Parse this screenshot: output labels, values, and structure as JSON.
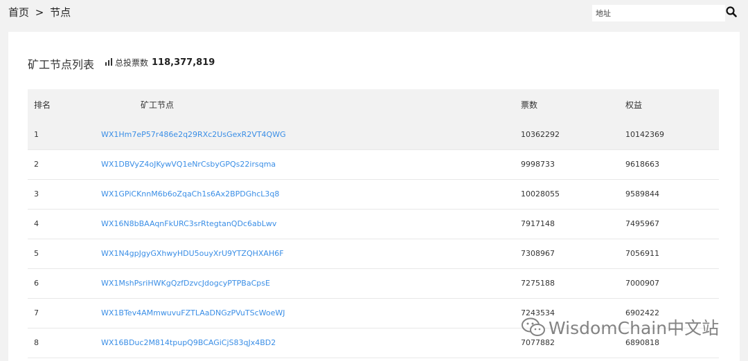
{
  "breadcrumb": {
    "home": "首页",
    "separator": ">",
    "current": "节点"
  },
  "search": {
    "placeholder": "地址",
    "icon": "search-icon"
  },
  "panel": {
    "title": "矿工节点列表",
    "total_votes_label": "总投票数",
    "total_votes_value": "118,377,819",
    "total_votes_icon": "bar-chart-icon"
  },
  "table": {
    "headers": {
      "rank": "排名",
      "node": "矿工节点",
      "votes": "票数",
      "rights": "权益"
    },
    "rows": [
      {
        "rank": "1",
        "node": "WX1Hm7eP57r486e2q29RXc2UsGexR2VT4QWG",
        "votes": "10362292",
        "rights": "10142369"
      },
      {
        "rank": "2",
        "node": "WX1DBVyZ4oJKywVQ1eNrCsbyGPQs22irsqma",
        "votes": "9998733",
        "rights": "9618663"
      },
      {
        "rank": "3",
        "node": "WX1GPiCKnnM6b6oZqaCh1s6Ax2BPDGhcL3q8",
        "votes": "10028055",
        "rights": "9589844"
      },
      {
        "rank": "4",
        "node": "WX16N8bBAAqnFkURC3srRtegtanQDc6abLwv",
        "votes": "7917148",
        "rights": "7495967"
      },
      {
        "rank": "5",
        "node": "WX1N4gpJgyGXhwyHDU5ouyXrU9YTZQHXAH6F",
        "votes": "7308967",
        "rights": "7056911"
      },
      {
        "rank": "6",
        "node": "WX1MshPsriHWKgQzfDzvcJdogcyPTPBaCpsE",
        "votes": "7275188",
        "rights": "7000907"
      },
      {
        "rank": "7",
        "node": "WX1BTev4AMmwuvuFZTLAaDNGzPVuTScWoeWJ",
        "votes": "7243534",
        "rights": "6902422"
      },
      {
        "rank": "8",
        "node": "WX16BDuc2M814tpupQ9BCAGiCjS83qJx4BD2",
        "votes": "7077882",
        "rights": "6890818"
      }
    ]
  },
  "watermark": {
    "text": "WisdomChain中文站",
    "icon": "wechat-icon"
  },
  "colors": {
    "link": "#3a8ee6",
    "page_bg": "#f2f2f2",
    "header_bg": "#f2f2f2"
  }
}
